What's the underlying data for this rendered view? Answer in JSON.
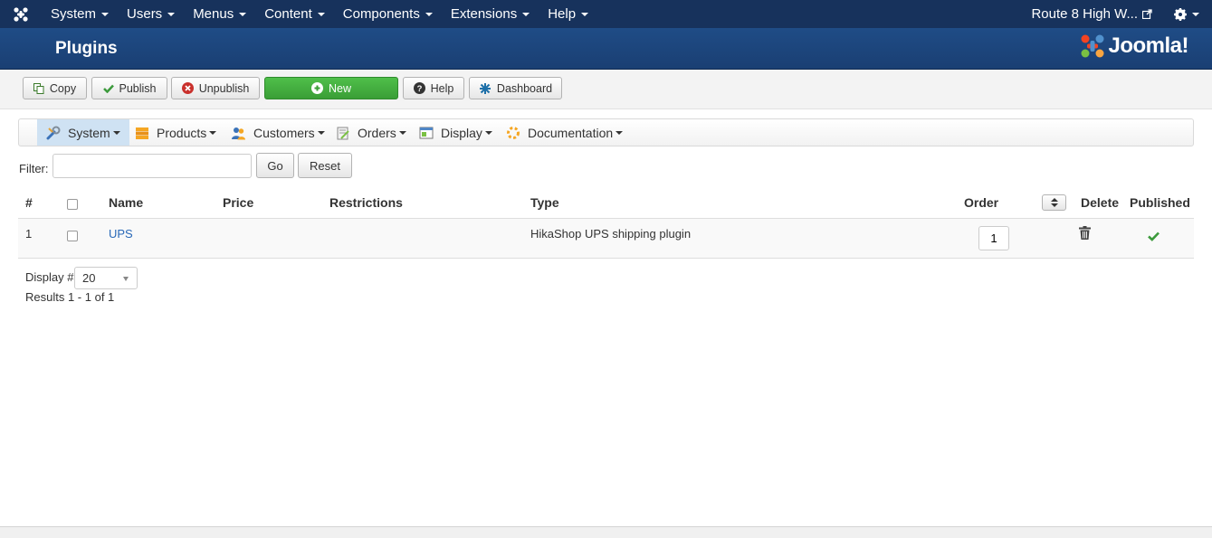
{
  "topnav": {
    "menu": [
      "System",
      "Users",
      "Menus",
      "Content",
      "Components",
      "Extensions",
      "Help"
    ],
    "site_name": "Route 8 High W..."
  },
  "header": {
    "title": "Plugins",
    "brand": "Joomla!"
  },
  "toolbar": {
    "copy": "Copy",
    "publish": "Publish",
    "unpublish": "Unpublish",
    "new": "New",
    "help": "Help",
    "dashboard": "Dashboard"
  },
  "subnav": {
    "items": [
      "System",
      "Products",
      "Customers",
      "Orders",
      "Display",
      "Documentation"
    ]
  },
  "filter": {
    "label": "Filter:",
    "value": "",
    "go": "Go",
    "reset": "Reset"
  },
  "table": {
    "columns": [
      "#",
      "Name",
      "Price",
      "Restrictions",
      "Type",
      "Order",
      "Delete",
      "Published"
    ],
    "rows": [
      {
        "num": "1",
        "name": "UPS",
        "price": "",
        "restrictions": "",
        "type": "HikaShop UPS shipping plugin",
        "order": "1",
        "published": true
      }
    ]
  },
  "pagination": {
    "display_label": "Display #",
    "display_value": "20",
    "results": "Results 1 - 1 of 1"
  },
  "colors": {
    "topnav_bg": "#17325c",
    "header_bg": "#1f4c86",
    "new_button": "#46b041",
    "link": "#2a69b8",
    "published_check": "#3c9a3c"
  }
}
